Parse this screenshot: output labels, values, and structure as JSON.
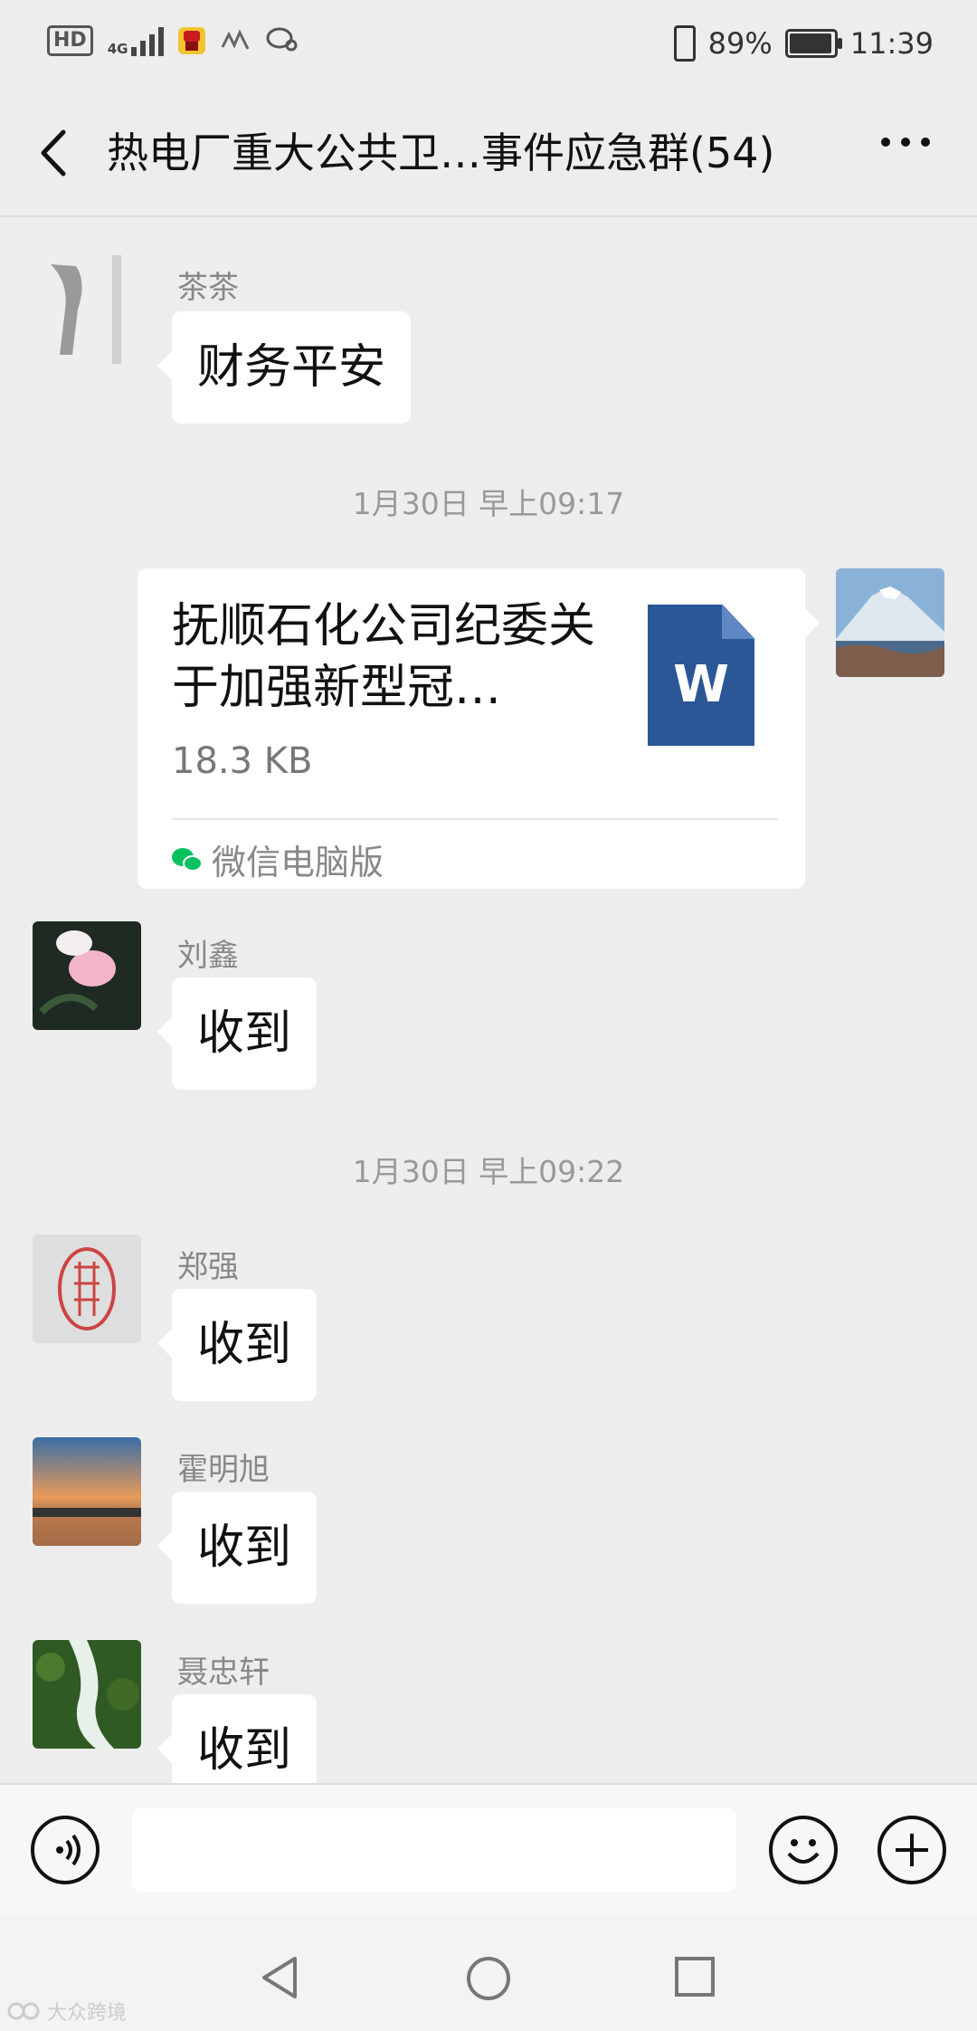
{
  "status_bar": {
    "hd": "HD",
    "network": "4G",
    "battery": "89%",
    "battery_level": 0.89,
    "time": "11:39"
  },
  "header": {
    "title": "热电厂重大公共卫…事件应急群(54)",
    "back_icon": "chevron-left-icon",
    "more_icon": "more-dots-icon"
  },
  "messages": [
    {
      "type": "text",
      "sender": "茶茶",
      "text": "财务平安"
    },
    {
      "type": "timestamp",
      "text": "1月30日 早上09:17"
    },
    {
      "type": "file",
      "sender": "me",
      "file_title": "抚顺石化公司纪委关于加强新型冠…",
      "file_size": "18.3 KB",
      "file_icon_letter": "W",
      "source": "微信电脑版"
    },
    {
      "type": "text",
      "sender": "刘鑫",
      "text": "收到"
    },
    {
      "type": "timestamp",
      "text": "1月30日 早上09:22"
    },
    {
      "type": "text",
      "sender": "郑强",
      "text": "收到"
    },
    {
      "type": "text",
      "sender": "霍明旭",
      "text": "收到"
    },
    {
      "type": "text",
      "sender": "聂忠轩",
      "text": "收到"
    }
  ],
  "input_bar": {
    "voice_icon": "voice-icon",
    "input_value": "",
    "emoji_icon": "emoji-icon",
    "plus_icon": "plus-icon"
  },
  "nav_bar": {
    "back_icon": "nav-back-icon",
    "home_icon": "nav-home-icon",
    "recent_icon": "nav-recent-icon"
  },
  "watermark": "大众跨境",
  "colors": {
    "background": "#ededed",
    "bubble": "#ffffff",
    "word_blue": "#2b5797",
    "wechat_green": "#07c160"
  }
}
